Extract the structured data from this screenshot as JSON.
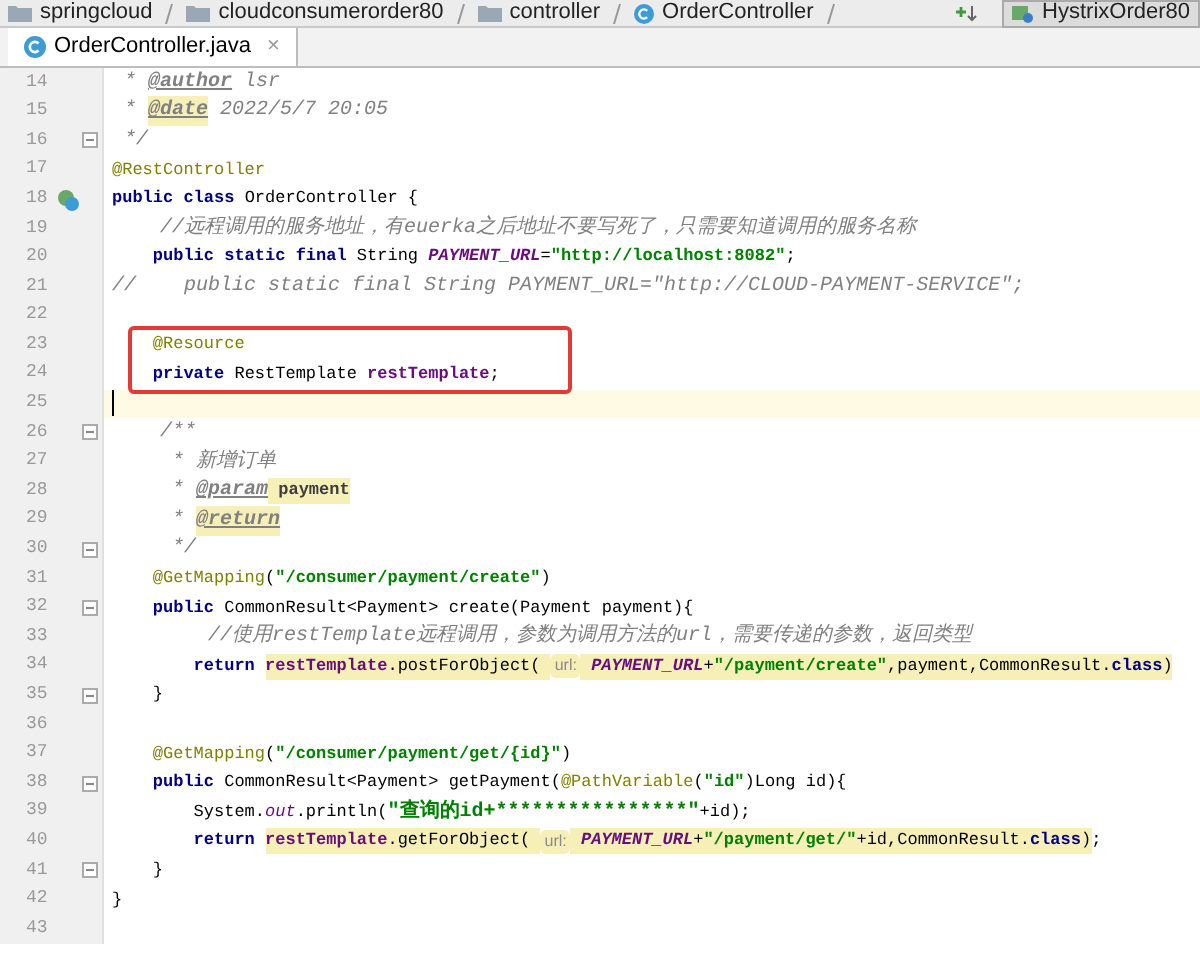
{
  "breadcrumbs": [
    {
      "label": "springcloud",
      "kind": "folder"
    },
    {
      "label": "cloudconsumerorder80",
      "kind": "folder"
    },
    {
      "label": "controller",
      "kind": "folder"
    },
    {
      "label": "OrderController",
      "kind": "class"
    }
  ],
  "run_config": {
    "label": "HystrixOrder80"
  },
  "tabs": [
    {
      "label": "OrderController.java",
      "selected": true,
      "close": "×"
    }
  ],
  "lines": [
    {
      "number": "14",
      "fold": false,
      "current": false,
      "boxed": false,
      "gutter_icon": false,
      "segments": [
        {
          "kind": "comment",
          "text": " * ",
          "marked": false
        },
        {
          "kind": "doctag",
          "text": "@author",
          "marked": false
        },
        {
          "kind": "comment",
          "text": " lsr",
          "marked": false
        }
      ]
    },
    {
      "number": "15",
      "fold": false,
      "current": false,
      "boxed": false,
      "gutter_icon": false,
      "segments": [
        {
          "kind": "comment",
          "text": " * ",
          "marked": false
        },
        {
          "kind": "doctag",
          "text": "@date",
          "marked": true
        },
        {
          "kind": "comment",
          "text": " 2022/5/7 20:05",
          "marked": false
        }
      ]
    },
    {
      "number": "16",
      "fold": true,
      "current": false,
      "boxed": false,
      "gutter_icon": false,
      "segments": [
        {
          "kind": "comment",
          "text": " */",
          "marked": false
        }
      ]
    },
    {
      "number": "17",
      "fold": false,
      "current": false,
      "boxed": false,
      "gutter_icon": false,
      "segments": [
        {
          "kind": "annotation",
          "text": "@RestController",
          "marked": false
        }
      ]
    },
    {
      "number": "18",
      "fold": false,
      "current": false,
      "boxed": false,
      "gutter_icon": true,
      "segments": [
        {
          "kind": "keyword",
          "text": "public class ",
          "marked": false
        },
        {
          "kind": "plain",
          "text": "OrderController {",
          "marked": false
        }
      ]
    },
    {
      "number": "19",
      "fold": false,
      "current": false,
      "boxed": false,
      "gutter_icon": false,
      "segments": [
        {
          "kind": "comment",
          "text": "    //远程调用的服务地址，有",
          "marked": false
        },
        {
          "kind": "comment_italic",
          "text": "euerka",
          "marked": false
        },
        {
          "kind": "comment",
          "text": "之后地址不要写死了，只需要知道调用的服务名称",
          "marked": false
        }
      ]
    },
    {
      "number": "20",
      "fold": false,
      "current": false,
      "boxed": false,
      "gutter_icon": false,
      "segments": [
        {
          "kind": "keyword",
          "text": "    public static final ",
          "marked": false
        },
        {
          "kind": "plain",
          "text": "String ",
          "marked": false
        },
        {
          "kind": "constant",
          "text": "PAYMENT_URL",
          "marked": false
        },
        {
          "kind": "plain",
          "text": "=",
          "marked": false
        },
        {
          "kind": "string",
          "text": "\"http://localhost:8082\"",
          "marked": false
        },
        {
          "kind": "plain",
          "text": ";",
          "marked": false
        }
      ]
    },
    {
      "number": "21",
      "fold": false,
      "current": false,
      "boxed": false,
      "gutter_icon": false,
      "segments": [
        {
          "kind": "comment",
          "text": "//    public static final String PAYMENT_URL=\"http://CLOUD-PAYMENT-SERVICE\";",
          "marked": false
        }
      ]
    },
    {
      "number": "22",
      "fold": false,
      "current": false,
      "boxed": false,
      "gutter_icon": false
    },
    {
      "number": "23",
      "fold": false,
      "current": false,
      "boxed": true,
      "gutter_icon": false,
      "segments": [
        {
          "kind": "annotation",
          "text": "    @Resource",
          "marked": false
        }
      ]
    },
    {
      "number": "24",
      "fold": false,
      "current": false,
      "boxed": true,
      "gutter_icon": false,
      "segments": [
        {
          "kind": "keyword",
          "text": "    private ",
          "marked": false
        },
        {
          "kind": "plain",
          "text": "RestTemplate ",
          "marked": false
        },
        {
          "kind": "field",
          "text": "restTemplate",
          "marked": false
        },
        {
          "kind": "plain",
          "text": ";",
          "marked": false
        }
      ]
    },
    {
      "number": "25",
      "fold": false,
      "current": true,
      "boxed": false,
      "gutter_icon": false
    },
    {
      "number": "26",
      "fold": true,
      "current": false,
      "boxed": false,
      "gutter_icon": false,
      "segments": [
        {
          "kind": "comment",
          "text": "    /**",
          "marked": false
        }
      ]
    },
    {
      "number": "27",
      "fold": false,
      "current": false,
      "boxed": false,
      "gutter_icon": false,
      "segments": [
        {
          "kind": "comment",
          "text": "     * 新增订单",
          "marked": false
        }
      ]
    },
    {
      "number": "28",
      "fold": false,
      "current": false,
      "boxed": false,
      "gutter_icon": false,
      "segments": [
        {
          "kind": "comment",
          "text": "     * ",
          "marked": false
        },
        {
          "kind": "doctag",
          "text": "@param",
          "marked": false
        },
        {
          "kind": "docvalue",
          "text": " payment",
          "marked": true
        }
      ]
    },
    {
      "number": "29",
      "fold": false,
      "current": false,
      "boxed": false,
      "gutter_icon": false,
      "segments": [
        {
          "kind": "comment",
          "text": "     * ",
          "marked": false
        },
        {
          "kind": "doctag",
          "text": "@return",
          "marked": true
        }
      ]
    },
    {
      "number": "30",
      "fold": true,
      "current": false,
      "boxed": false,
      "gutter_icon": false,
      "segments": [
        {
          "kind": "comment",
          "text": "     */",
          "marked": false
        }
      ]
    },
    {
      "number": "31",
      "fold": false,
      "current": false,
      "boxed": false,
      "gutter_icon": false,
      "segments": [
        {
          "kind": "annotation",
          "text": "    @GetMapping",
          "marked": false
        },
        {
          "kind": "plain",
          "text": "(",
          "marked": false
        },
        {
          "kind": "string",
          "text": "\"/consumer/payment/create\"",
          "marked": false
        },
        {
          "kind": "plain",
          "text": ")",
          "marked": false
        }
      ]
    },
    {
      "number": "32",
      "fold": true,
      "current": false,
      "boxed": false,
      "gutter_icon": false,
      "segments": [
        {
          "kind": "keyword",
          "text": "    public ",
          "marked": false
        },
        {
          "kind": "plain",
          "text": "CommonResult<Payment> create(Payment payment){",
          "marked": false
        }
      ]
    },
    {
      "number": "33",
      "fold": false,
      "current": false,
      "boxed": false,
      "gutter_icon": false,
      "segments": [
        {
          "kind": "comment",
          "text": "        //使用",
          "marked": false
        },
        {
          "kind": "comment_italic",
          "text": "restTemplate",
          "marked": false
        },
        {
          "kind": "comment",
          "text": "远程调用，参数为调用方法的",
          "marked": false
        },
        {
          "kind": "comment_italic",
          "text": "url",
          "marked": false
        },
        {
          "kind": "comment",
          "text": "，需要传递的参数，返回类型",
          "marked": false
        }
      ]
    },
    {
      "number": "34",
      "fold": false,
      "current": false,
      "boxed": false,
      "gutter_icon": false,
      "segments": [
        {
          "kind": "keyword",
          "text": "        return ",
          "marked": false
        },
        {
          "kind": "field",
          "text": "restTemplate",
          "marked": true
        },
        {
          "kind": "plain",
          "text": ".postForObject( ",
          "marked": true
        },
        {
          "kind": "hint",
          "text": "url:",
          "marked": true
        },
        {
          "kind": "constant",
          "text": " PAYMENT_URL",
          "marked": true
        },
        {
          "kind": "plain",
          "text": "+",
          "marked": true
        },
        {
          "kind": "string",
          "text": "\"/payment/create\"",
          "marked": true
        },
        {
          "kind": "plain",
          "text": ",payment,CommonResult.",
          "marked": true
        },
        {
          "kind": "keyword",
          "text": "class",
          "marked": true
        },
        {
          "kind": "plain",
          "text": ")",
          "marked": true
        }
      ]
    },
    {
      "number": "35",
      "fold": true,
      "current": false,
      "boxed": false,
      "gutter_icon": false,
      "segments": [
        {
          "kind": "plain",
          "text": "    }",
          "marked": false
        }
      ]
    },
    {
      "number": "36",
      "fold": false,
      "current": false,
      "boxed": false,
      "gutter_icon": false
    },
    {
      "number": "37",
      "fold": false,
      "current": false,
      "boxed": false,
      "gutter_icon": false,
      "segments": [
        {
          "kind": "annotation",
          "text": "    @GetMapping",
          "marked": false
        },
        {
          "kind": "plain",
          "text": "(",
          "marked": false
        },
        {
          "kind": "string",
          "text": "\"/consumer/payment/get/{id}\"",
          "marked": false
        },
        {
          "kind": "plain",
          "text": ")",
          "marked": false
        }
      ]
    },
    {
      "number": "38",
      "fold": true,
      "current": false,
      "boxed": false,
      "gutter_icon": false,
      "segments": [
        {
          "kind": "keyword",
          "text": "    public ",
          "marked": false
        },
        {
          "kind": "plain",
          "text": "CommonResult<Payment> getPayment(",
          "marked": false
        },
        {
          "kind": "annotation",
          "text": "@PathVariable",
          "marked": false
        },
        {
          "kind": "plain",
          "text": "(",
          "marked": false
        },
        {
          "kind": "string",
          "text": "\"id\"",
          "marked": false
        },
        {
          "kind": "plain",
          "text": ")Long id){",
          "marked": false
        }
      ]
    },
    {
      "number": "39",
      "fold": false,
      "current": false,
      "boxed": false,
      "gutter_icon": false,
      "segments": [
        {
          "kind": "plain",
          "text": "        System.",
          "marked": false
        },
        {
          "kind": "static_field",
          "text": "out",
          "marked": false
        },
        {
          "kind": "plain",
          "text": ".println(",
          "marked": false
        },
        {
          "kind": "string_cjk",
          "text": "\"查询的id+****************\"",
          "marked": false
        },
        {
          "kind": "plain",
          "text": "+id);",
          "marked": false
        }
      ]
    },
    {
      "number": "40",
      "fold": false,
      "current": false,
      "boxed": false,
      "gutter_icon": false,
      "segments": [
        {
          "kind": "keyword",
          "text": "        return ",
          "marked": false
        },
        {
          "kind": "field",
          "text": "restTemplate",
          "marked": true
        },
        {
          "kind": "plain",
          "text": ".getForObject( ",
          "marked": true
        },
        {
          "kind": "hint",
          "text": "url:",
          "marked": true
        },
        {
          "kind": "constant",
          "text": " PAYMENT_URL",
          "marked": true
        },
        {
          "kind": "plain",
          "text": "+",
          "marked": true
        },
        {
          "kind": "string",
          "text": "\"/payment/get/\"",
          "marked": true
        },
        {
          "kind": "plain",
          "text": "+id,CommonResult.",
          "marked": true
        },
        {
          "kind": "keyword",
          "text": "class",
          "marked": true
        },
        {
          "kind": "plain",
          "text": ")",
          "marked": true
        },
        {
          "kind": "plain",
          "text": ";",
          "marked": false
        }
      ]
    },
    {
      "number": "41",
      "fold": true,
      "current": false,
      "boxed": false,
      "gutter_icon": false,
      "segments": [
        {
          "kind": "plain",
          "text": "    }",
          "marked": false
        }
      ]
    },
    {
      "number": "42",
      "fold": false,
      "current": false,
      "boxed": false,
      "gutter_icon": false,
      "segments": [
        {
          "kind": "plain",
          "text": "}",
          "marked": false
        }
      ]
    },
    {
      "number": "43",
      "fold": false,
      "current": false,
      "boxed": false,
      "gutter_icon": false
    }
  ]
}
